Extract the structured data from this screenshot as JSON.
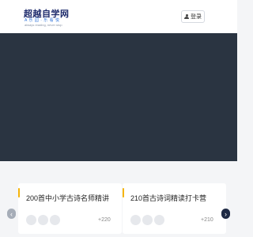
{
  "header": {
    "logo": {
      "title": "超越自学网",
      "slogan": "A 乐 园 · 乐 看 悦",
      "subtitle": "always reading, never stop"
    },
    "login_label": "登录"
  },
  "courses": [
    {
      "title": "200首中小学古诗名师精讲",
      "count": "+220"
    },
    {
      "title": "210首古诗词精读打卡营",
      "count": "+210"
    }
  ],
  "carousel": {
    "prev_symbol": "‹",
    "next_symbol": "›"
  },
  "colors": {
    "accent": "#f5b40a",
    "banner": "#2a3441",
    "next_arrow": "#1f2a44"
  }
}
